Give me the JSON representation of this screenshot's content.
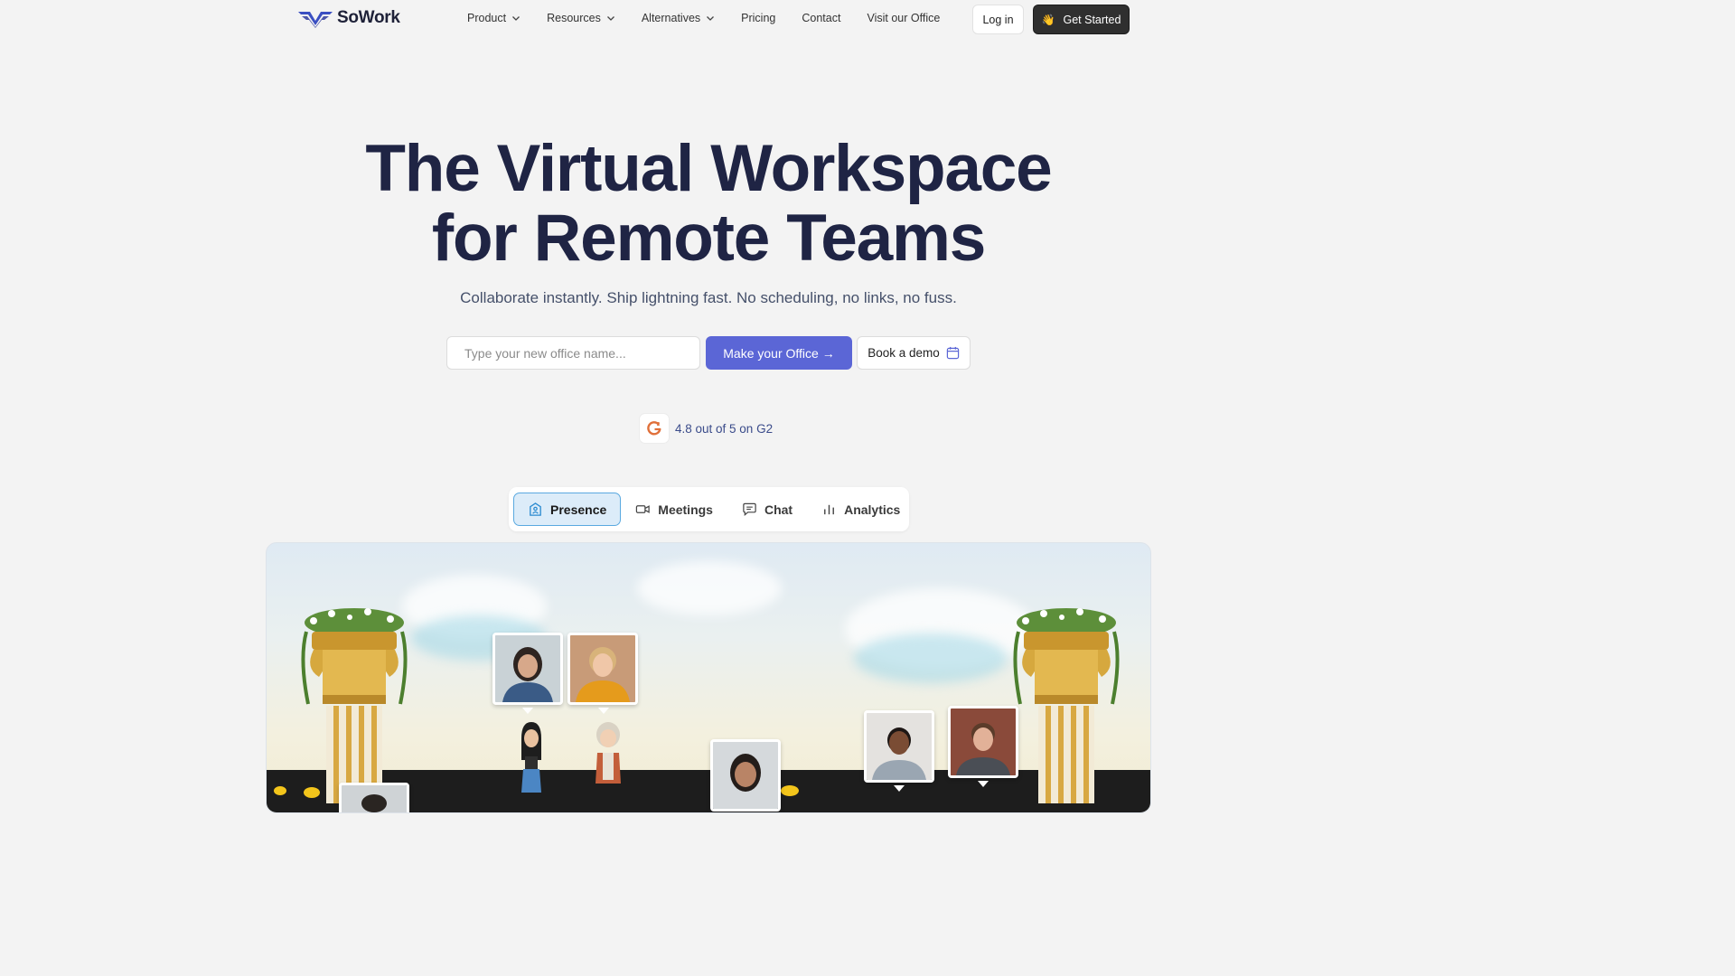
{
  "brand": {
    "name": "SoWork"
  },
  "nav": {
    "items": [
      {
        "label": "Product",
        "dropdown": true
      },
      {
        "label": "Resources",
        "dropdown": true
      },
      {
        "label": "Alternatives",
        "dropdown": true
      },
      {
        "label": "Pricing",
        "dropdown": false
      },
      {
        "label": "Contact",
        "dropdown": false
      },
      {
        "label": "Visit our Office",
        "dropdown": false
      }
    ],
    "login_label": "Log in",
    "get_started_label": "Get Started",
    "get_started_icon": "👋"
  },
  "hero": {
    "title_line1": "The Virtual Workspace",
    "title_line2": "for Remote Teams",
    "subtitle": "Collaborate instantly. Ship lightning fast. No scheduling, no links, no fuss.",
    "input_placeholder": "Type your new office name...",
    "make_office_label": "Make your Office →",
    "book_demo_label": "Book a demo"
  },
  "rating": {
    "text": "4.8 out of 5 on G2",
    "badge_icon": "g2-logo-icon"
  },
  "tabs": [
    {
      "label": "Presence",
      "icon": "office-icon",
      "active": true
    },
    {
      "label": "Meetings",
      "icon": "video-camera-icon",
      "active": false
    },
    {
      "label": "Chat",
      "icon": "chat-bubble-icon",
      "active": false
    },
    {
      "label": "Analytics",
      "icon": "bar-chart-icon",
      "active": false
    }
  ],
  "colors": {
    "background": "#f3f3f3",
    "title": "#1f2444",
    "accent": "#5b66d6",
    "dark_button": "#2f2f2f",
    "tab_active_bg": "#dcecf9",
    "tab_active_border": "#5aa9e0"
  }
}
